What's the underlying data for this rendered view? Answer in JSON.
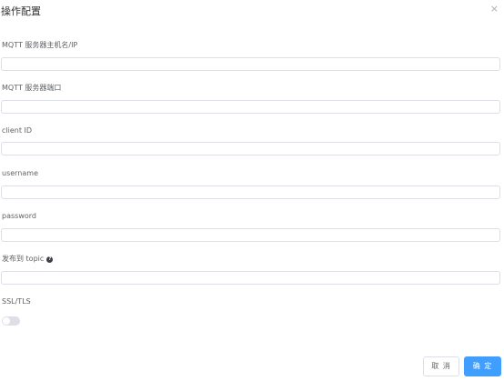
{
  "dialog": {
    "title": "操作配置",
    "close_glyph": "×"
  },
  "fields": {
    "host": {
      "label": "MQTT 服务器主机名/IP",
      "value": ""
    },
    "port": {
      "label": "MQTT 服务器端口",
      "value": ""
    },
    "client_id": {
      "label": "client ID",
      "value": ""
    },
    "username": {
      "label": "username",
      "value": ""
    },
    "password": {
      "label": "password",
      "value": ""
    },
    "topic": {
      "label": "发布到 topic",
      "help_glyph": "?",
      "value": ""
    },
    "ssl": {
      "label": "SSL/TLS",
      "enabled": false
    }
  },
  "footer": {
    "cancel_label": "取 消",
    "confirm_label": "确 定"
  },
  "colors": {
    "primary": "#409eff",
    "border": "#dcdfe6",
    "switch_off": "#dcdfe6"
  }
}
